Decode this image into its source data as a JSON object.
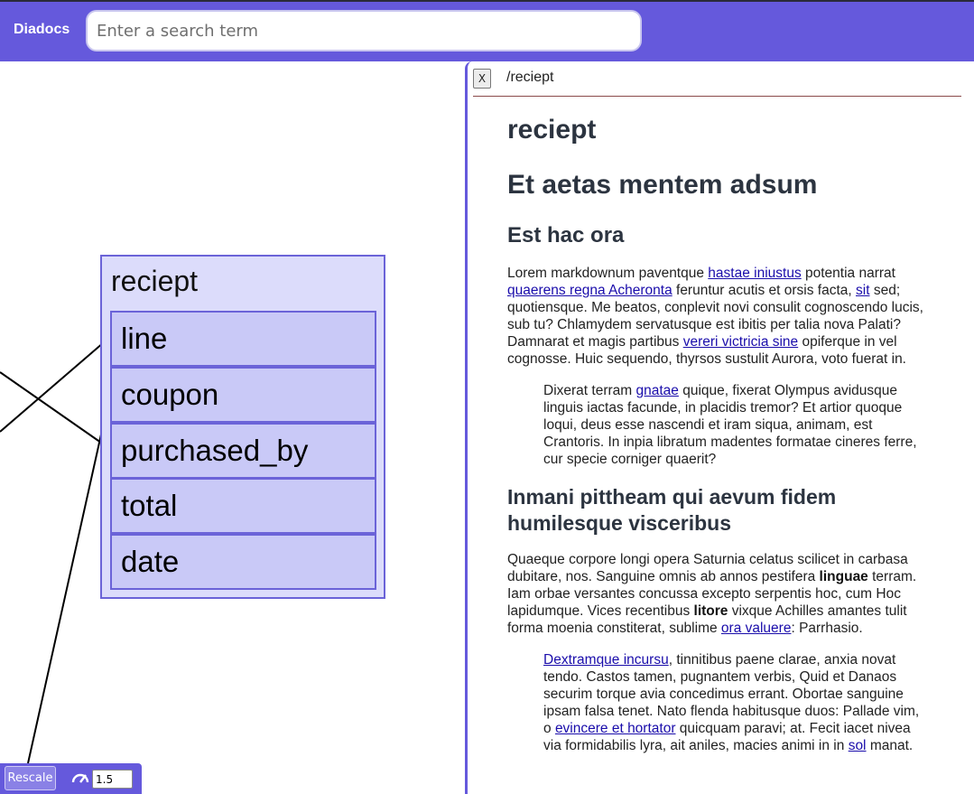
{
  "header": {
    "logo": "Diadocs",
    "search_placeholder": "Enter a search term"
  },
  "diagram": {
    "table_title": "reciept",
    "fields": [
      "line",
      "coupon",
      "purchased_by",
      "total",
      "date"
    ]
  },
  "controls": {
    "rescale_label": "Rescale",
    "zoom_value": "1.5"
  },
  "doc_panel": {
    "close_label": "X",
    "path": "/reciept",
    "title": "reciept",
    "h1": "Et aetas mentem adsum",
    "sections": [
      {
        "heading": "Est hac ora",
        "p1": {
          "t1": "Lorem markdownum paventque ",
          "l1": "hastae iniustus",
          "t2": " potentia narrat ",
          "l2": "quaerens regna Acheronta",
          "t3": " feruntur acutis et orsis facta, ",
          "l3": "sit",
          "t4": " sed; quotiensque. Me beatos, conplevit novi consulit cognoscendo lucis, sub tu? Chlamydem servatusque est ibitis per talia nova Palati? Damnarat et magis partibus ",
          "l4": "vereri victricia sine",
          "t5": " opiferque in vel cognosse. Huic sequendo, thyrsos sustulit Aurora, voto fuerat in."
        },
        "quote": {
          "t1": "Dixerat terram ",
          "l1": "gnatae",
          "t2": " quique, fixerat Olympus avidusque linguis iactas facunde, in placidis tremor? Et artior quoque loqui, deus esse nascendi et iram siqua, animam, est Crantoris. In inpia libratum madentes formatae cineres ferre, cur specie corniger quaerit?"
        }
      },
      {
        "heading": "Inmani pittheam qui aevum fidem humilesque visceribus",
        "p1": {
          "t1": "Quaeque corpore longi opera Saturnia celatus scilicet in carbasa dubitare, nos. Sanguine omnis ab annos pestifera ",
          "b1": "linguae",
          "t2": " terram. Iam orbae versantes concussa excepto serpentis hoc, cum Hoc lapidumque. Vices recentibus ",
          "b2": "litore",
          "t3": " vixque Achilles amantes tulit forma moenia constiterat, sublime ",
          "l1": "ora valuere",
          "t4": ": Parrhasio."
        },
        "quote": {
          "l1": "Dextramque incursu",
          "t1": ", tinnitibus paene clarae, anxia novat tendo. Castos tamen, pugnantem verbis, Quid et Danaos securim torque avia concedimus errant. Obortae sanguine ipsam falsa tenet. Nato flenda habitusque duos: Pallade vim, o ",
          "l2": "evincere et hortator",
          "t2": " quicquam paravi; at. Fecit iacet nivea via formidabilis lyra, ait aniles, macies animi in in ",
          "l3": "sol",
          "t3": " manat."
        }
      }
    ]
  }
}
